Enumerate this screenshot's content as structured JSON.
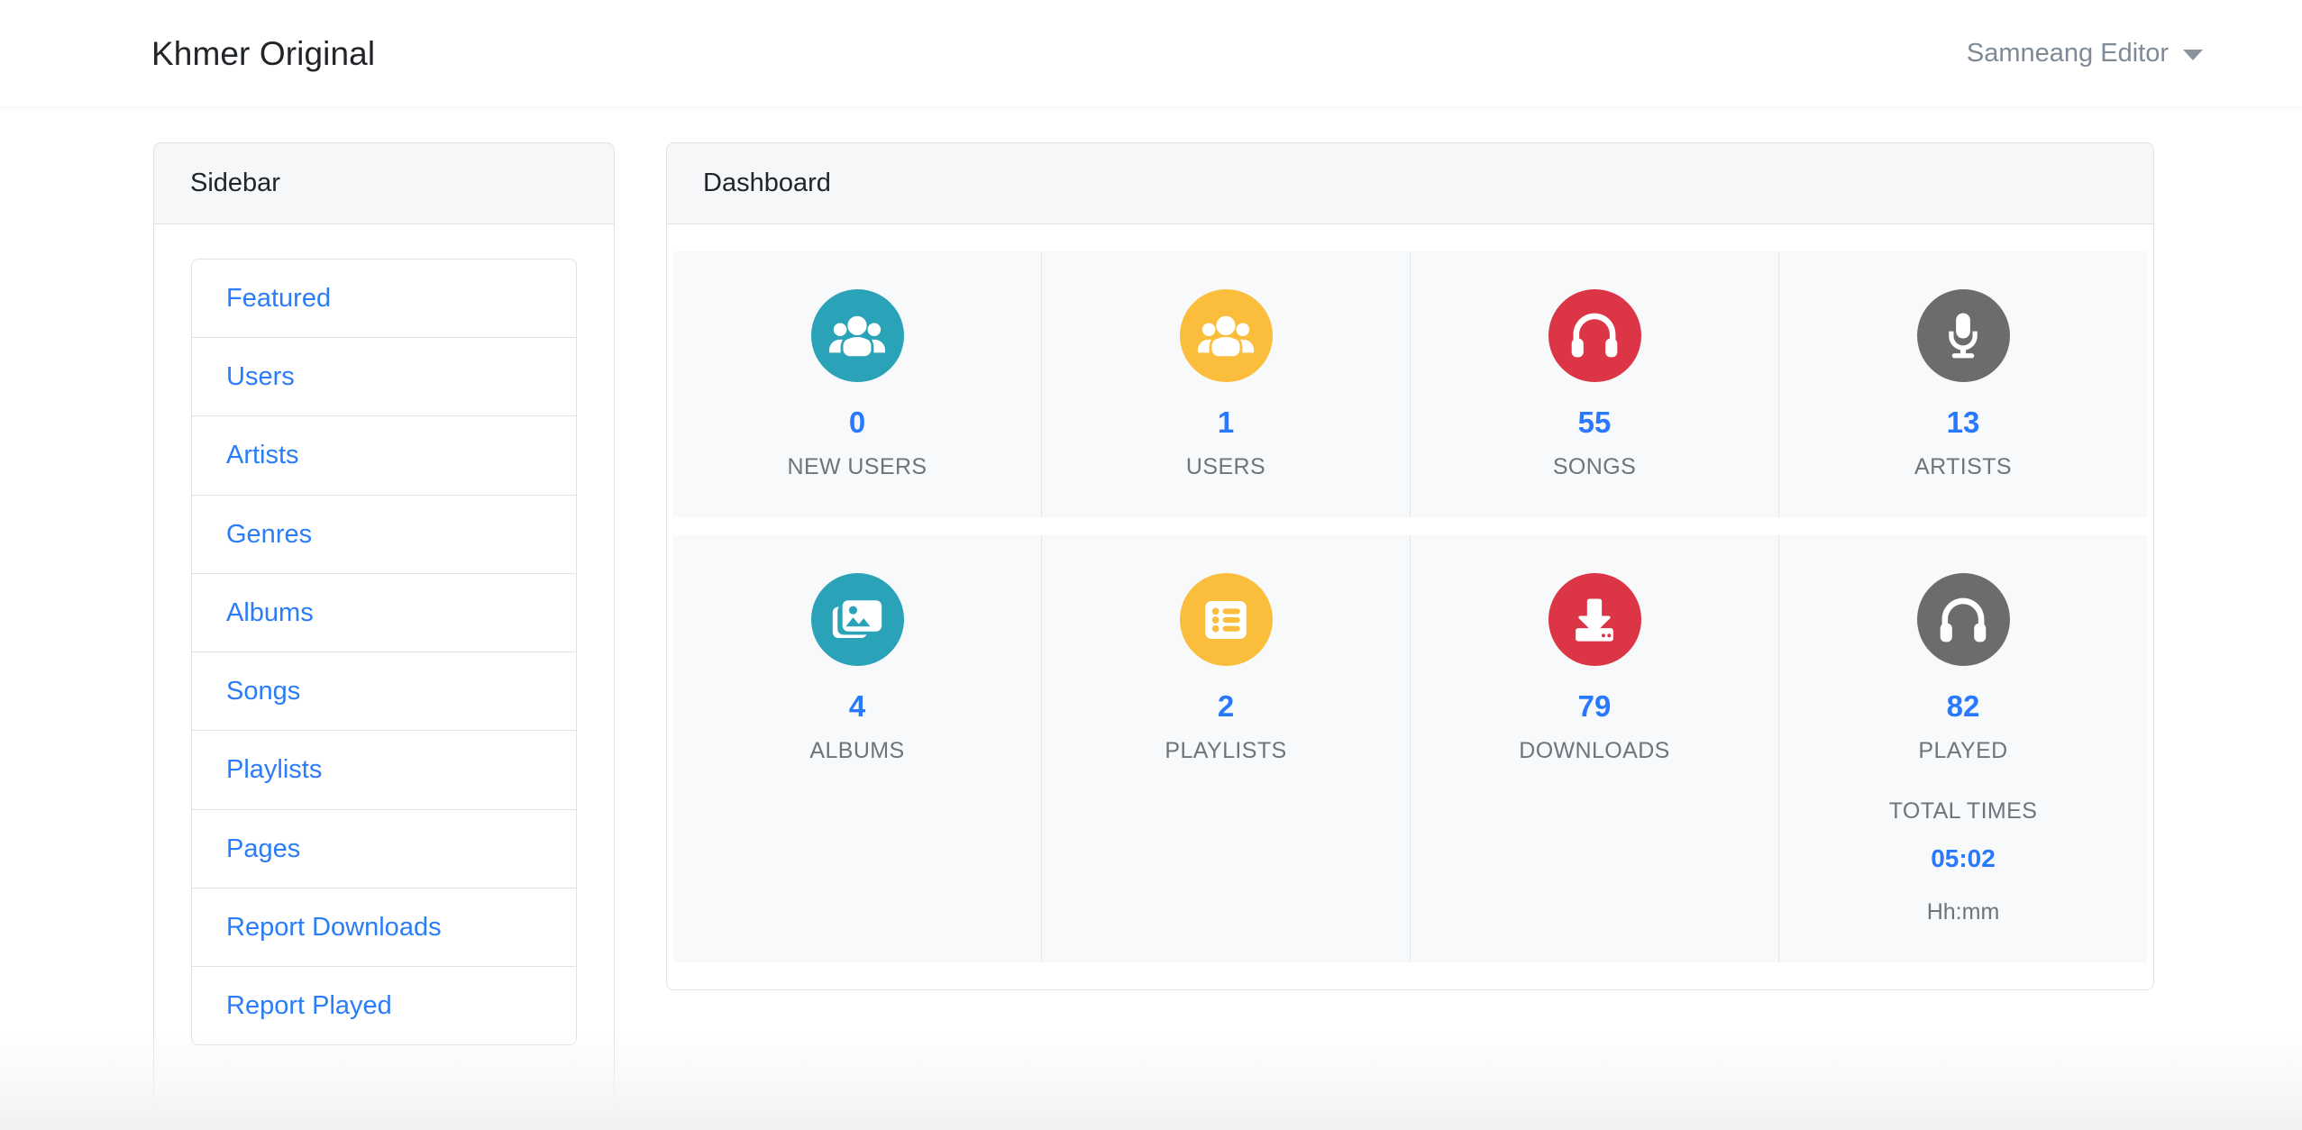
{
  "navbar": {
    "brand": "Khmer Original",
    "user_name": "Samneang Editor"
  },
  "sidebar": {
    "title": "Sidebar",
    "items": [
      {
        "label": "Featured"
      },
      {
        "label": "Users"
      },
      {
        "label": "Artists"
      },
      {
        "label": "Genres"
      },
      {
        "label": "Albums"
      },
      {
        "label": "Songs"
      },
      {
        "label": "Playlists"
      },
      {
        "label": "Pages"
      },
      {
        "label": "Report Downloads"
      },
      {
        "label": "Report Played"
      }
    ]
  },
  "dashboard": {
    "title": "Dashboard",
    "stats_top": [
      {
        "value": "0",
        "label": "NEW USERS",
        "icon": "users-group-icon",
        "color": "#2aa3b8"
      },
      {
        "value": "1",
        "label": "USERS",
        "icon": "users-group-icon",
        "color": "#fbbd3c"
      },
      {
        "value": "55",
        "label": "SONGS",
        "icon": "headphones-icon",
        "color": "#dc3545"
      },
      {
        "value": "13",
        "label": "ARTISTS",
        "icon": "microphone-icon",
        "color": "#6c6c6c"
      }
    ],
    "stats_bottom": [
      {
        "value": "4",
        "label": "ALBUMS",
        "icon": "images-icon",
        "color": "#2aa3b8"
      },
      {
        "value": "2",
        "label": "PLAYLISTS",
        "icon": "list-alt-icon",
        "color": "#fbbd3c"
      },
      {
        "value": "79",
        "label": "DOWNLOADS",
        "icon": "download-icon",
        "color": "#dc3545"
      },
      {
        "value": "82",
        "label": "PLAYED",
        "icon": "headphones-icon",
        "color": "#6c6c6c",
        "sub_label": "TOTAL TIMES",
        "sub_value": "05:02",
        "sub_note": "Hh:mm"
      }
    ]
  },
  "colors": {
    "link": "#2a7cf7",
    "stat_value": "#2979ff",
    "muted": "#6c757d",
    "teal": "#2aa3b8",
    "amber": "#fbbd3c",
    "crimson": "#dc3545",
    "gray": "#6c6c6c"
  }
}
